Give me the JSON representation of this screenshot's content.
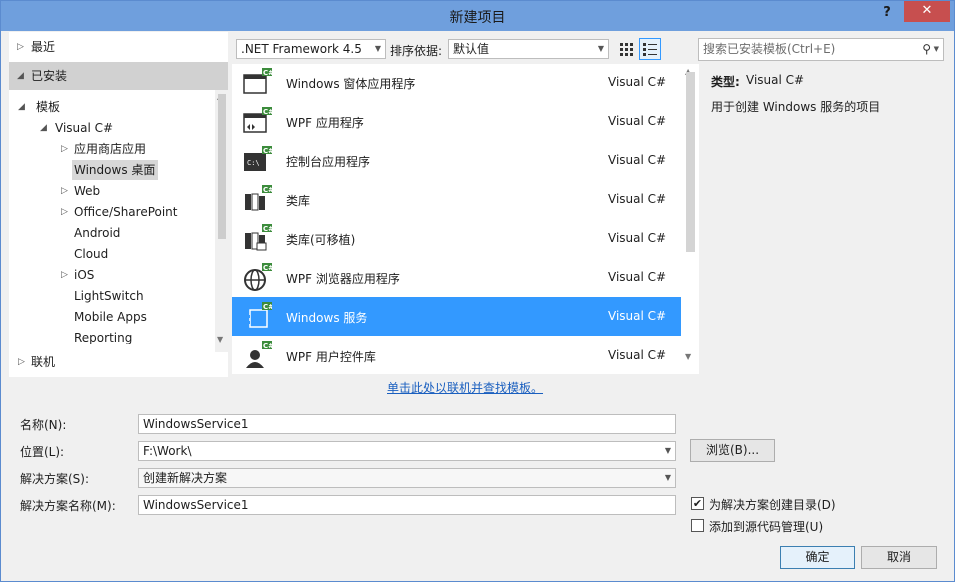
{
  "window": {
    "title": "新建项目",
    "help_label": "?",
    "close_label": "✕"
  },
  "tree": {
    "recent": "最近",
    "installed": "已安装",
    "templates": "模板",
    "visual_csharp": "Visual C#",
    "children": [
      "应用商店应用",
      "Windows 桌面",
      "Web",
      "Office/SharePoint",
      "Android",
      "Cloud",
      "iOS",
      "LightSwitch",
      "Mobile Apps",
      "Reporting"
    ],
    "online": "联机"
  },
  "toolbar": {
    "framework": ".NET Framework 4.5",
    "sort_label": "排序依据:",
    "sort_value": "默认值",
    "search_placeholder": "搜索已安装模板(Ctrl+E)"
  },
  "templates": [
    {
      "name": "Windows 窗体应用程序",
      "lang": "Visual C#",
      "icon": "winforms-icon"
    },
    {
      "name": "WPF 应用程序",
      "lang": "Visual C#",
      "icon": "wpf-app-icon"
    },
    {
      "name": "控制台应用程序",
      "lang": "Visual C#",
      "icon": "console-icon"
    },
    {
      "name": "类库",
      "lang": "Visual C#",
      "icon": "class-library-icon"
    },
    {
      "name": "类库(可移植)",
      "lang": "Visual C#",
      "icon": "portable-library-icon"
    },
    {
      "name": "WPF 浏览器应用程序",
      "lang": "Visual C#",
      "icon": "globe-icon"
    },
    {
      "name": "Windows 服务",
      "lang": "Visual C#",
      "icon": "service-icon"
    },
    {
      "name": "WPF 用户控件库",
      "lang": "Visual C#",
      "icon": "user-control-icon"
    }
  ],
  "info": {
    "type_label": "类型:",
    "type_value": "Visual C#",
    "description": "用于创建 Windows 服务的项目"
  },
  "online_link": "单击此处以联机并查找模板。",
  "form": {
    "name_label": "名称(N):",
    "name_value": "WindowsService1",
    "location_label": "位置(L):",
    "location_value": "F:\\Work\\",
    "solution_label": "解决方案(S):",
    "solution_value": "创建新解决方案",
    "solution_name_label": "解决方案名称(M):",
    "solution_name_value": "WindowsService1",
    "browse_label": "浏览(B)...",
    "create_dir_label": "为解决方案创建目录(D)",
    "create_dir_checked": true,
    "source_control_label": "添加到源代码管理(U)",
    "source_control_checked": false,
    "ok_label": "确定",
    "cancel_label": "取消"
  },
  "colors": {
    "accent": "#3399ff",
    "titlebar": "#6f9fdd",
    "close": "#c74f4f",
    "csharp_badge": "#3c8c3c"
  }
}
